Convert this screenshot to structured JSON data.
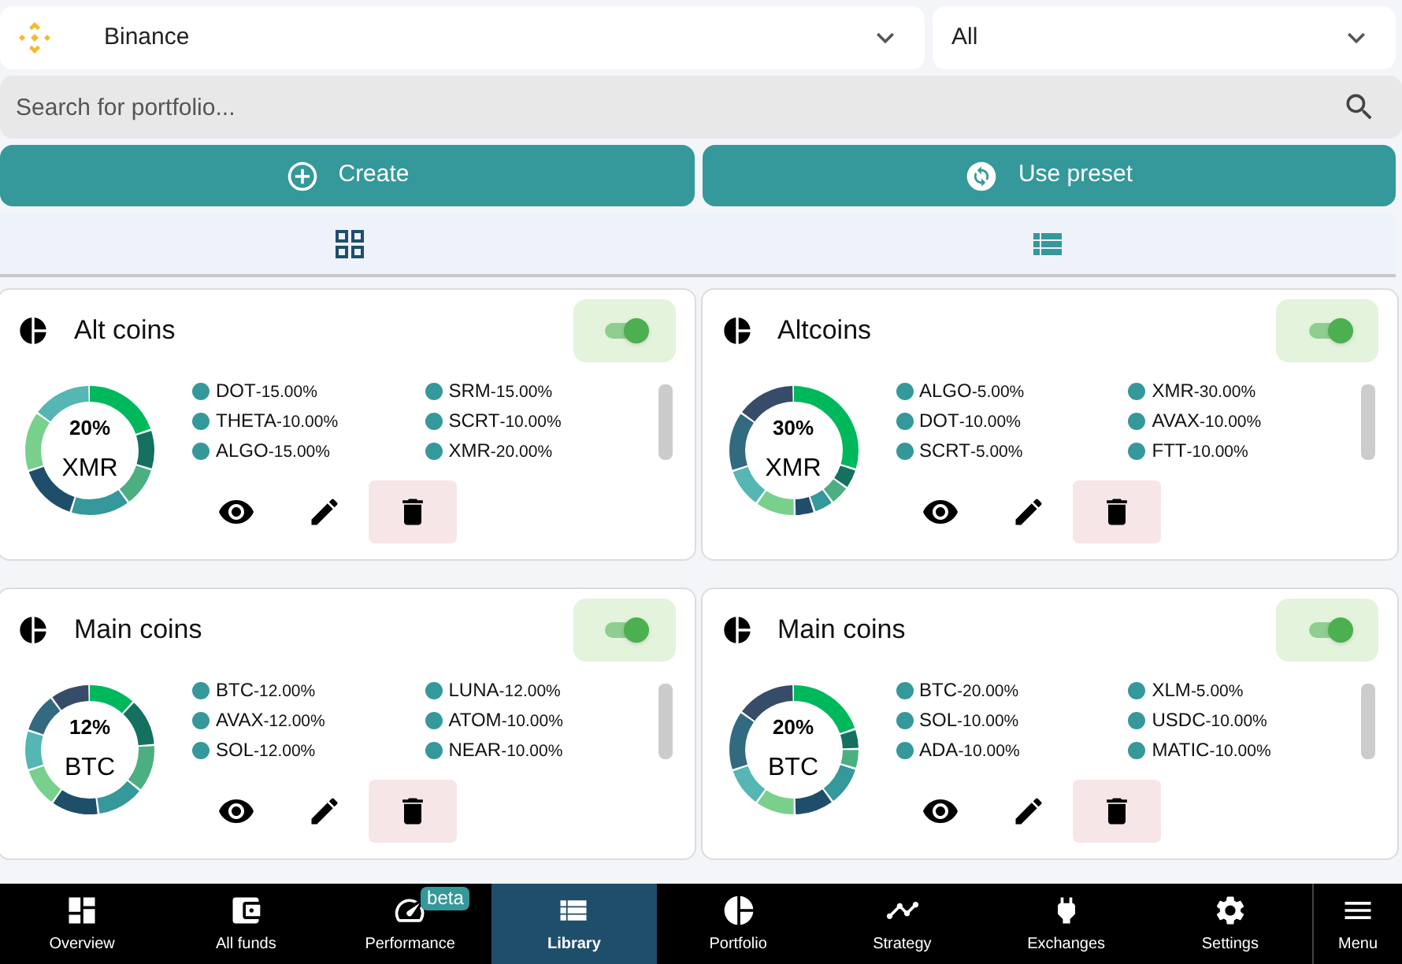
{
  "exchange_select": {
    "value": "Binance"
  },
  "filter_select": {
    "value": "All"
  },
  "search": {
    "placeholder": "Search for portfolio..."
  },
  "actions": [
    {
      "kind": "create",
      "label": "Create"
    },
    {
      "kind": "preset",
      "label": "Use preset"
    }
  ],
  "view_modes": [
    {
      "kind": "grid"
    },
    {
      "kind": "list"
    }
  ],
  "portfolios": [
    {
      "title": "Alt coins",
      "on": true,
      "center_percent": "20%",
      "center_coin": "XMR",
      "holdings": [
        {
          "coin": "DOT",
          "share": "-15.00%"
        },
        {
          "coin": "THETA",
          "share": "-10.00%"
        },
        {
          "coin": "ALGO",
          "share": "-15.00%"
        },
        {
          "coin": "SRM",
          "share": "-15.00%"
        },
        {
          "coin": "SCRT",
          "share": "-10.00%"
        },
        {
          "coin": "XMR",
          "share": "-20.00%"
        }
      ]
    },
    {
      "title": "Altcoins",
      "on": true,
      "center_percent": "30%",
      "center_coin": "XMR",
      "holdings": [
        {
          "coin": "ALGO",
          "share": "-5.00%"
        },
        {
          "coin": "DOT",
          "share": "-10.00%"
        },
        {
          "coin": "SCRT",
          "share": "-5.00%"
        },
        {
          "coin": "XMR",
          "share": "-30.00%"
        },
        {
          "coin": "AVAX",
          "share": "-10.00%"
        },
        {
          "coin": "FTT",
          "share": "-10.00%"
        }
      ]
    },
    {
      "title": "Main coins",
      "on": true,
      "center_percent": "12%",
      "center_coin": "BTC",
      "holdings": [
        {
          "coin": "BTC",
          "share": "-12.00%"
        },
        {
          "coin": "AVAX",
          "share": "-12.00%"
        },
        {
          "coin": "SOL",
          "share": "-12.00%"
        },
        {
          "coin": "LUNA",
          "share": "-12.00%"
        },
        {
          "coin": "ATOM",
          "share": "-10.00%"
        },
        {
          "coin": "NEAR",
          "share": "-10.00%"
        }
      ]
    },
    {
      "title": "Main coins",
      "on": true,
      "center_percent": "20%",
      "center_coin": "BTC",
      "holdings": [
        {
          "coin": "BTC",
          "share": "-20.00%"
        },
        {
          "coin": "SOL",
          "share": "-10.00%"
        },
        {
          "coin": "ADA",
          "share": "-10.00%"
        },
        {
          "coin": "XLM",
          "share": "-5.00%"
        },
        {
          "coin": "USDC",
          "share": "-10.00%"
        },
        {
          "coin": "MATIC",
          "share": "-10.00%"
        }
      ]
    }
  ],
  "nav": [
    {
      "kind": "overview",
      "label": "Overview",
      "selected": false
    },
    {
      "kind": "funds",
      "label": "All funds",
      "selected": false
    },
    {
      "kind": "performance",
      "label": "Performance",
      "selected": false,
      "badge": "beta"
    },
    {
      "kind": "library",
      "label": "Library",
      "selected": true
    },
    {
      "kind": "portfolio",
      "label": "Portfolio",
      "selected": false
    },
    {
      "kind": "strategy",
      "label": "Strategy",
      "selected": false
    },
    {
      "kind": "exchanges",
      "label": "Exchanges",
      "selected": false
    },
    {
      "kind": "settings",
      "label": "Settings",
      "selected": false
    },
    {
      "kind": "menu",
      "label": "Menu",
      "selected": false
    }
  ]
}
